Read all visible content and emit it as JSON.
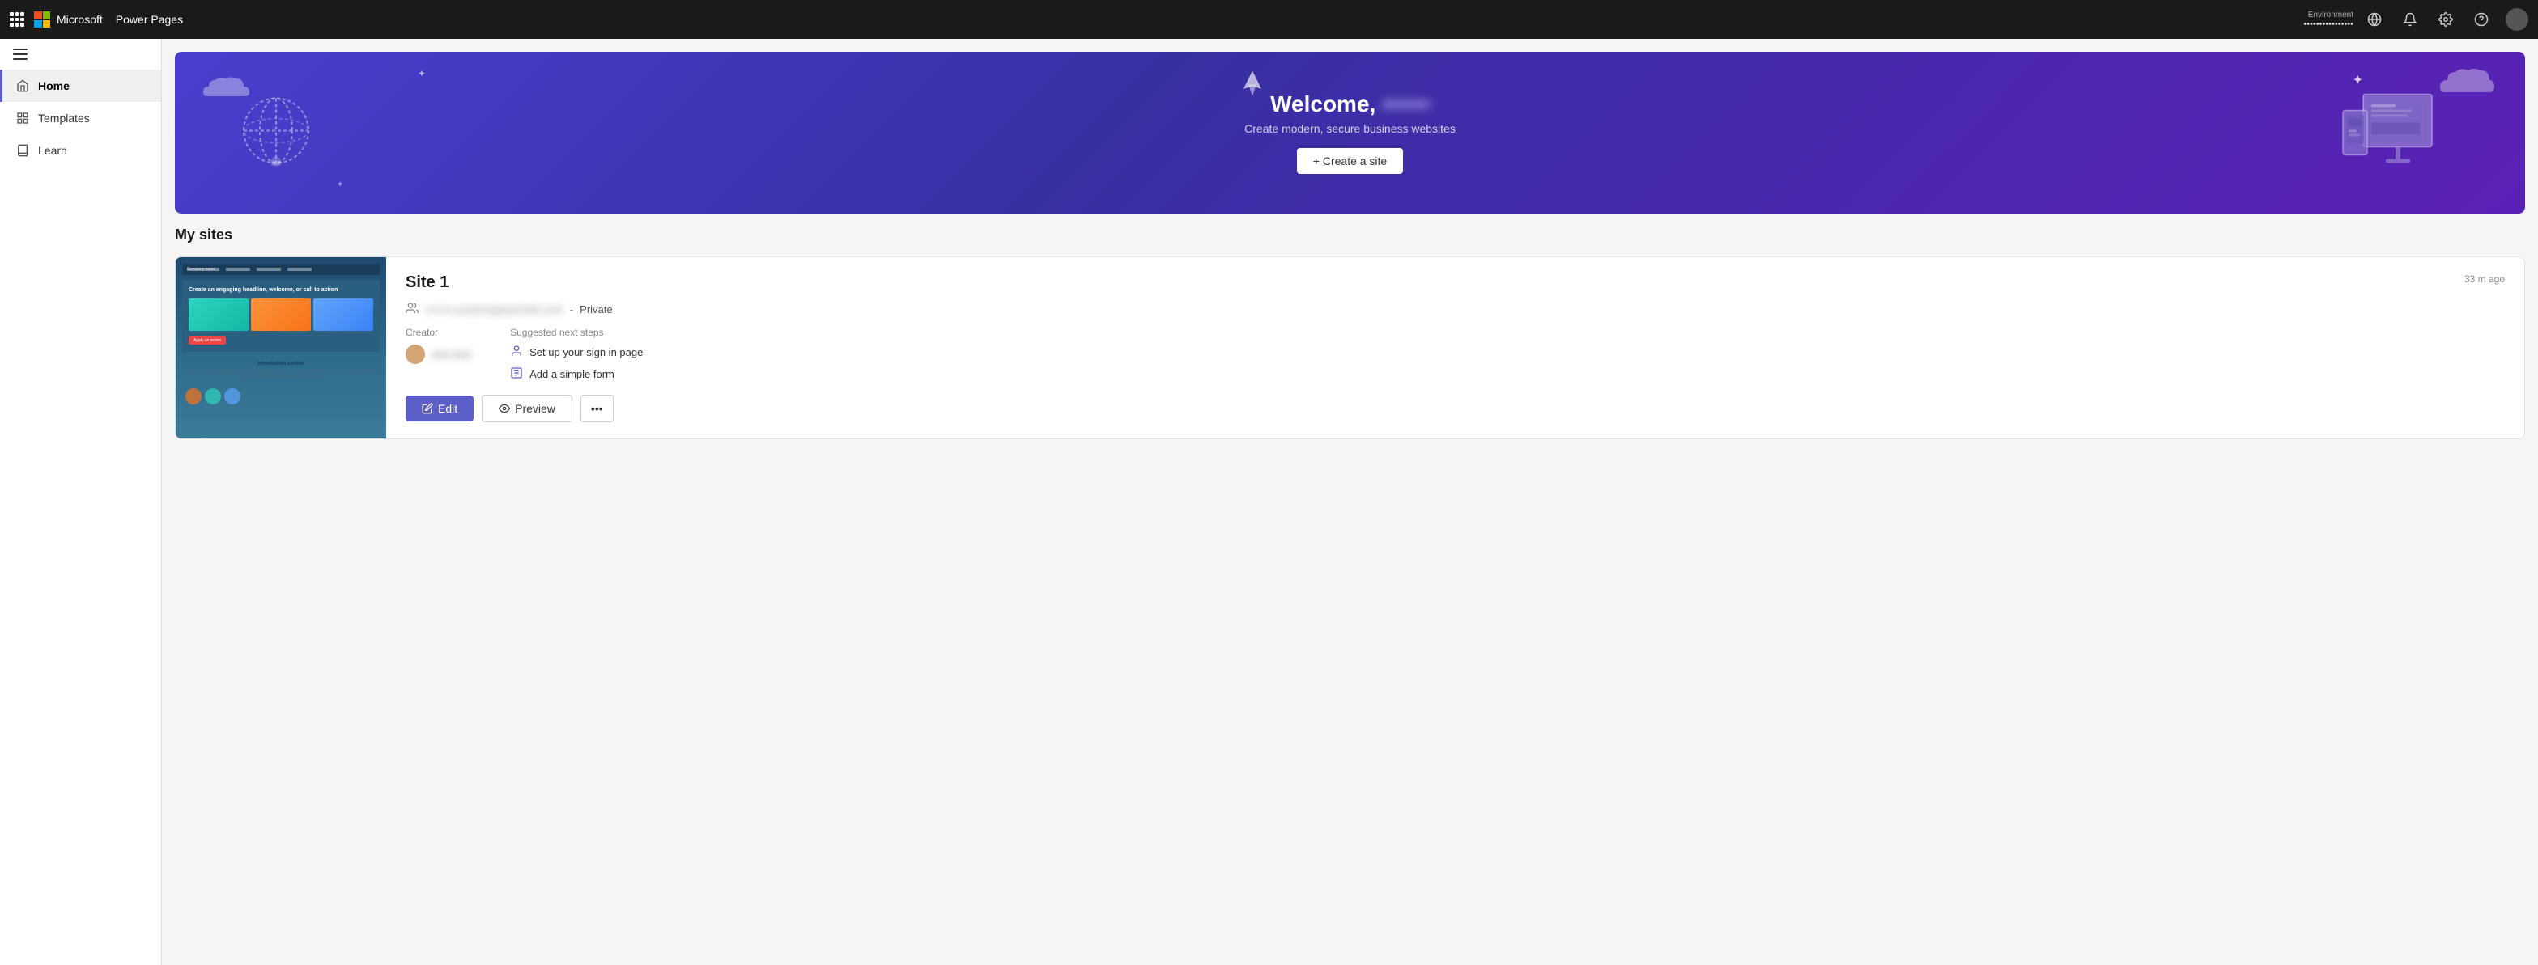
{
  "app": {
    "name": "Microsoft",
    "product": "Power Pages"
  },
  "topbar": {
    "env_label": "Environment",
    "env_value": "••••••••••••••••",
    "notifications_icon": "🔔",
    "settings_icon": "⚙",
    "help_icon": "?"
  },
  "sidebar": {
    "items": [
      {
        "id": "home",
        "label": "Home",
        "icon": "home",
        "active": true
      },
      {
        "id": "templates",
        "label": "Templates",
        "icon": "grid",
        "active": false
      },
      {
        "id": "learn",
        "label": "Learn",
        "icon": "book",
        "active": false
      }
    ]
  },
  "hero": {
    "title": "Welcome,",
    "subtitle": "Create modern, secure business websites",
    "cta_label": "+ Create a site"
  },
  "my_sites": {
    "section_title": "My sites",
    "sites": [
      {
        "name": "Site 1",
        "timestamp": "33 m ago",
        "url": "••••••••.powerappsportals.com",
        "privacy": "Private",
        "creator_label": "Creator",
        "creator_name": "••••• •••••",
        "next_steps_label": "Suggested next steps",
        "next_steps": [
          {
            "label": "Set up your sign in page",
            "icon": "person"
          },
          {
            "label": "Add a simple form",
            "icon": "form"
          }
        ],
        "edit_label": "Edit",
        "preview_label": "Preview",
        "more_label": "•••"
      }
    ]
  }
}
